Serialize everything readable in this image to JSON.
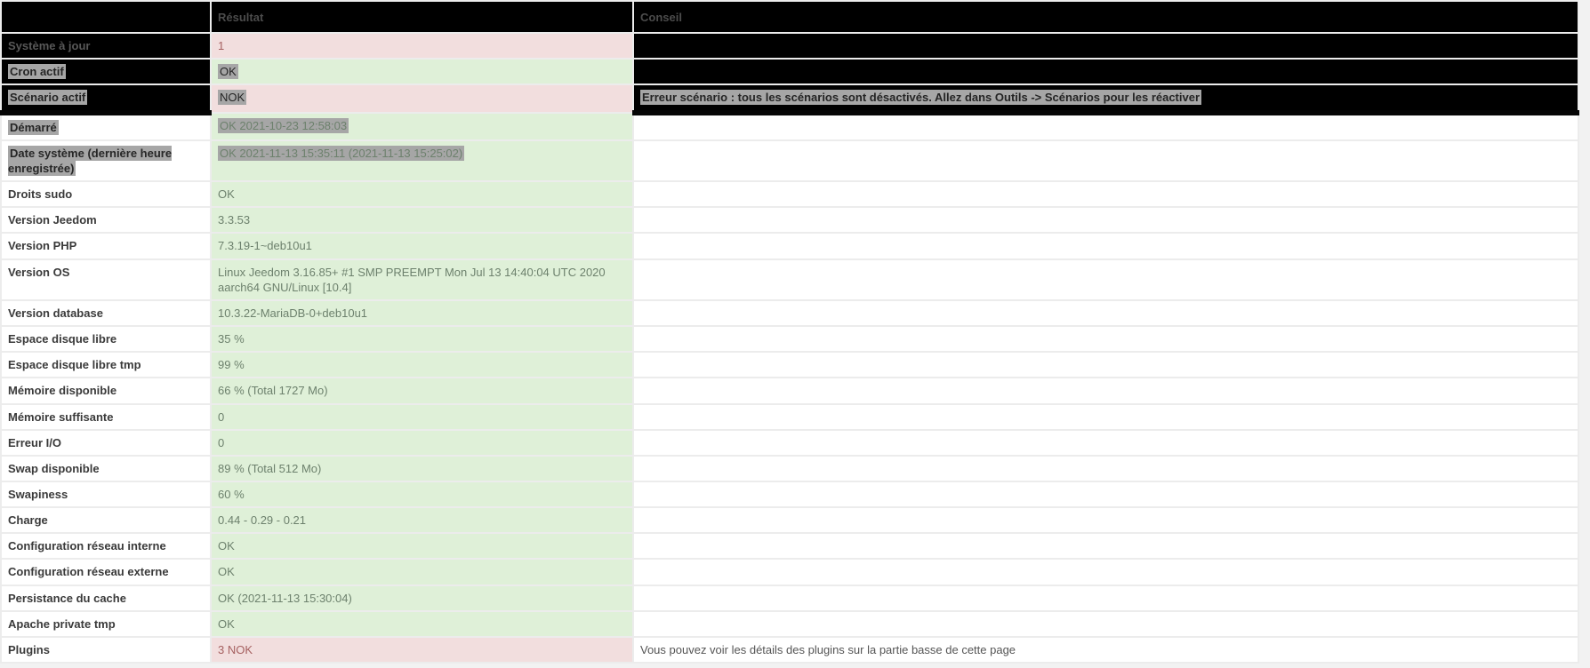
{
  "table": {
    "columns": [
      "",
      "Résultat",
      "Conseil"
    ],
    "colors": {
      "dark_row_bg": "#000000",
      "success_bg": "#dff0d8",
      "success_text": "#6d816d",
      "danger_bg": "#f2dede",
      "danger_text": "#a66161",
      "selection_highlight": "#a6a6a6",
      "header_text": "#4c4c4c",
      "label_text": "#3a3a3a"
    },
    "rows": [
      {
        "label": "Système à jour",
        "value": "1",
        "status": "danger",
        "conseil": "",
        "dark": true,
        "sel_label": false,
        "sel_value": false,
        "sel_conseil": false
      },
      {
        "label": "Cron actif",
        "value": "OK",
        "status": "success",
        "conseil": "",
        "dark": true,
        "sel_label": true,
        "sel_value": true,
        "sel_conseil": false
      },
      {
        "label": "Scénario actif",
        "value": "NOK",
        "status": "danger",
        "conseil": "Erreur scénario : tous les scénarios sont désactivés. Allez dans Outils -> Scénarios pour les réactiver",
        "dark": true,
        "sel_label": true,
        "sel_value": true,
        "sel_conseil": true
      },
      {
        "label": "Démarré",
        "value": "OK 2021-10-23 12:58:03",
        "status": "success",
        "conseil": "",
        "dark": false,
        "sel_label": true,
        "sel_value": true,
        "sel_conseil": false
      },
      {
        "label": "Date système (dernière heure enregistrée)",
        "value": "OK 2021-11-13 15:35:11 (2021-11-13 15:25:02)",
        "status": "success",
        "conseil": "",
        "dark": false,
        "sel_label": true,
        "sel_value": true,
        "sel_conseil": false
      },
      {
        "label": "Droits sudo",
        "value": "OK",
        "status": "success",
        "conseil": "",
        "dark": false,
        "sel_label": false,
        "sel_value": false,
        "sel_conseil": false
      },
      {
        "label": "Version Jeedom",
        "value": "3.3.53",
        "status": "success",
        "conseil": "",
        "dark": false,
        "sel_label": false,
        "sel_value": false,
        "sel_conseil": false
      },
      {
        "label": "Version PHP",
        "value": "7.3.19-1~deb10u1",
        "status": "success",
        "conseil": "",
        "dark": false,
        "sel_label": false,
        "sel_value": false,
        "sel_conseil": false
      },
      {
        "label": "Version OS",
        "value": "Linux Jeedom 3.16.85+ #1 SMP PREEMPT Mon Jul 13 14:40:04 UTC 2020 aarch64 GNU/Linux [10.4]",
        "status": "success",
        "conseil": "",
        "dark": false,
        "sel_label": false,
        "sel_value": false,
        "sel_conseil": false
      },
      {
        "label": "Version database",
        "value": "10.3.22-MariaDB-0+deb10u1",
        "status": "success",
        "conseil": "",
        "dark": false,
        "sel_label": false,
        "sel_value": false,
        "sel_conseil": false
      },
      {
        "label": "Espace disque libre",
        "value": "35 %",
        "status": "success",
        "conseil": "",
        "dark": false,
        "sel_label": false,
        "sel_value": false,
        "sel_conseil": false
      },
      {
        "label": "Espace disque libre tmp",
        "value": "99 %",
        "status": "success",
        "conseil": "",
        "dark": false,
        "sel_label": false,
        "sel_value": false,
        "sel_conseil": false
      },
      {
        "label": "Mémoire disponible",
        "value": "66 % (Total 1727 Mo)",
        "status": "success",
        "conseil": "",
        "dark": false,
        "sel_label": false,
        "sel_value": false,
        "sel_conseil": false
      },
      {
        "label": "Mémoire suffisante",
        "value": "0",
        "status": "success",
        "conseil": "",
        "dark": false,
        "sel_label": false,
        "sel_value": false,
        "sel_conseil": false
      },
      {
        "label": "Erreur I/O",
        "value": "0",
        "status": "success",
        "conseil": "",
        "dark": false,
        "sel_label": false,
        "sel_value": false,
        "sel_conseil": false
      },
      {
        "label": "Swap disponible",
        "value": "89 % (Total 512 Mo)",
        "status": "success",
        "conseil": "",
        "dark": false,
        "sel_label": false,
        "sel_value": false,
        "sel_conseil": false
      },
      {
        "label": "Swapiness",
        "value": "60 %",
        "status": "success",
        "conseil": "",
        "dark": false,
        "sel_label": false,
        "sel_value": false,
        "sel_conseil": false
      },
      {
        "label": "Charge",
        "value": "0.44 - 0.29 - 0.21",
        "status": "success",
        "conseil": "",
        "dark": false,
        "sel_label": false,
        "sel_value": false,
        "sel_conseil": false
      },
      {
        "label": "Configuration réseau interne",
        "value": "OK",
        "status": "success",
        "conseil": "",
        "dark": false,
        "sel_label": false,
        "sel_value": false,
        "sel_conseil": false
      },
      {
        "label": "Configuration réseau externe",
        "value": "OK",
        "status": "success",
        "conseil": "",
        "dark": false,
        "sel_label": false,
        "sel_value": false,
        "sel_conseil": false
      },
      {
        "label": "Persistance du cache",
        "value": "OK (2021-11-13 15:30:04)",
        "status": "success",
        "conseil": "",
        "dark": false,
        "sel_label": false,
        "sel_value": false,
        "sel_conseil": false
      },
      {
        "label": "Apache private tmp",
        "value": "OK",
        "status": "success",
        "conseil": "",
        "dark": false,
        "sel_label": false,
        "sel_value": false,
        "sel_conseil": false
      },
      {
        "label": "Plugins",
        "value": "3 NOK",
        "status": "danger",
        "conseil": "Vous pouvez voir les détails des plugins sur la partie basse de cette page",
        "dark": false,
        "sel_label": false,
        "sel_value": false,
        "sel_conseil": false
      }
    ]
  }
}
